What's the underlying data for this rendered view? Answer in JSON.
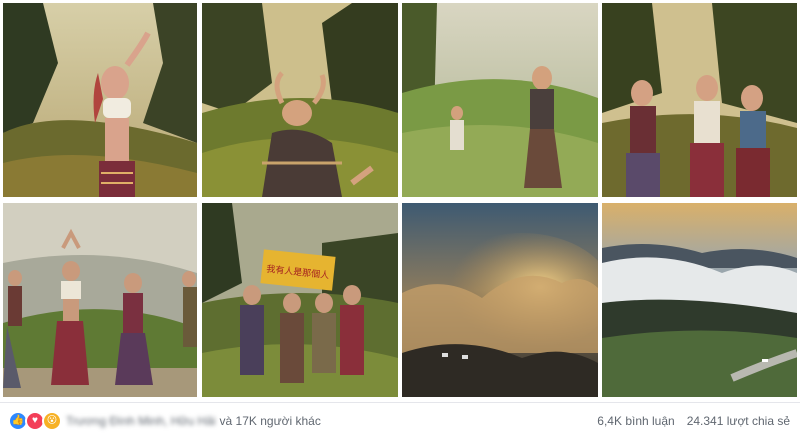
{
  "photos": [
    {
      "alt": "photo-1"
    },
    {
      "alt": "photo-2"
    },
    {
      "alt": "photo-3"
    },
    {
      "alt": "photo-4"
    },
    {
      "alt": "photo-5"
    },
    {
      "alt": "photo-6"
    },
    {
      "alt": "photo-7"
    },
    {
      "alt": "photo-8"
    }
  ],
  "banner_text": "我有人是那個人",
  "footer": {
    "reaction_icons": [
      "like-icon",
      "love-icon",
      "wow-icon"
    ],
    "names": "Trương Đình Minh, Hữu Hải",
    "others": "và 17K người khác",
    "comments": "6,4K bình luận",
    "shares": "24.341 lượt chia sẻ"
  },
  "colors": {
    "like": "#2d88ff",
    "love": "#f33e58",
    "wow": "#f7b125",
    "footer_text": "#606770"
  }
}
